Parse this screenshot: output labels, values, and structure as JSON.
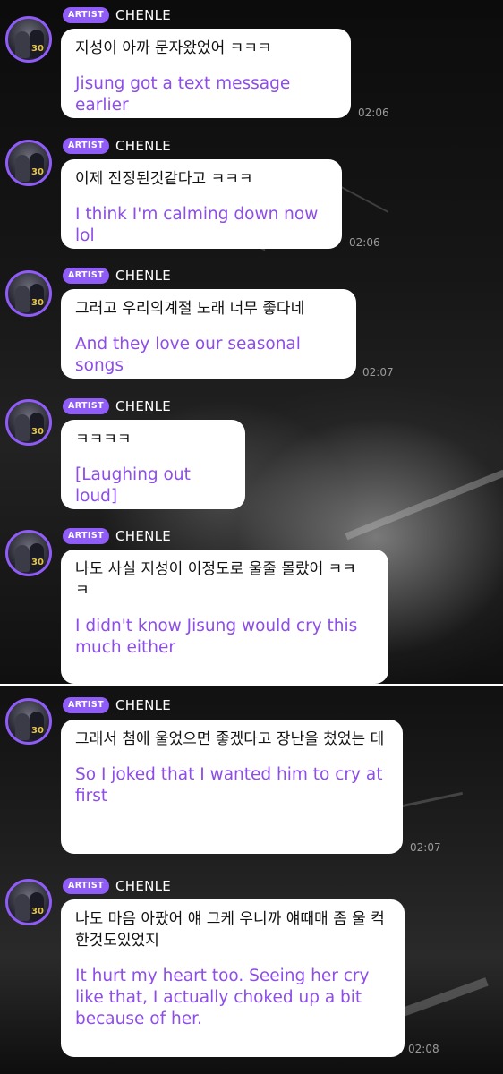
{
  "sender": {
    "badge": "ARTIST",
    "name": "CHENLE",
    "avatar_jersey_number": "30"
  },
  "colors": {
    "accent": "#8f5cf7",
    "translation_text": "#8d4de8",
    "bubble": "#ffffff",
    "timestamp": "#9a9a9a"
  },
  "messages": [
    {
      "korean": "지성이 아까 문자왔었어 ㅋㅋㅋ",
      "english": "Jisung got a text message earlier",
      "time": "02:06"
    },
    {
      "korean": "이제 진정된것같다고 ㅋㅋㅋ",
      "english": "I think I'm calming down now lol",
      "time": "02:06"
    },
    {
      "korean": "그러고 우리의계절 노래 너무 좋다네",
      "english": "And they love our seasonal songs",
      "time": "02:07"
    },
    {
      "korean": "ㅋㅋㅋㅋ",
      "english": "[Laughing out loud]",
      "time": ""
    },
    {
      "korean": "나도 사실 지성이 이정도로 울줄 몰랐어 ㅋㅋ ㅋ",
      "english": "I didn't know Jisung would cry this much either",
      "time": ""
    },
    {
      "korean": "그래서 첨에 울었으면 좋겠다고 장난을 쳤었는 데",
      "english": "So I joked that I wanted him to cry at first",
      "time": "02:07"
    },
    {
      "korean": "나도 마음 아팠어 얘 그케 우니까 얘때매 좀 울 컥한것도있었지",
      "english": "It hurt my heart too. Seeing her cry like that, I actually choked up a bit because of her.",
      "time": "02:08"
    }
  ]
}
